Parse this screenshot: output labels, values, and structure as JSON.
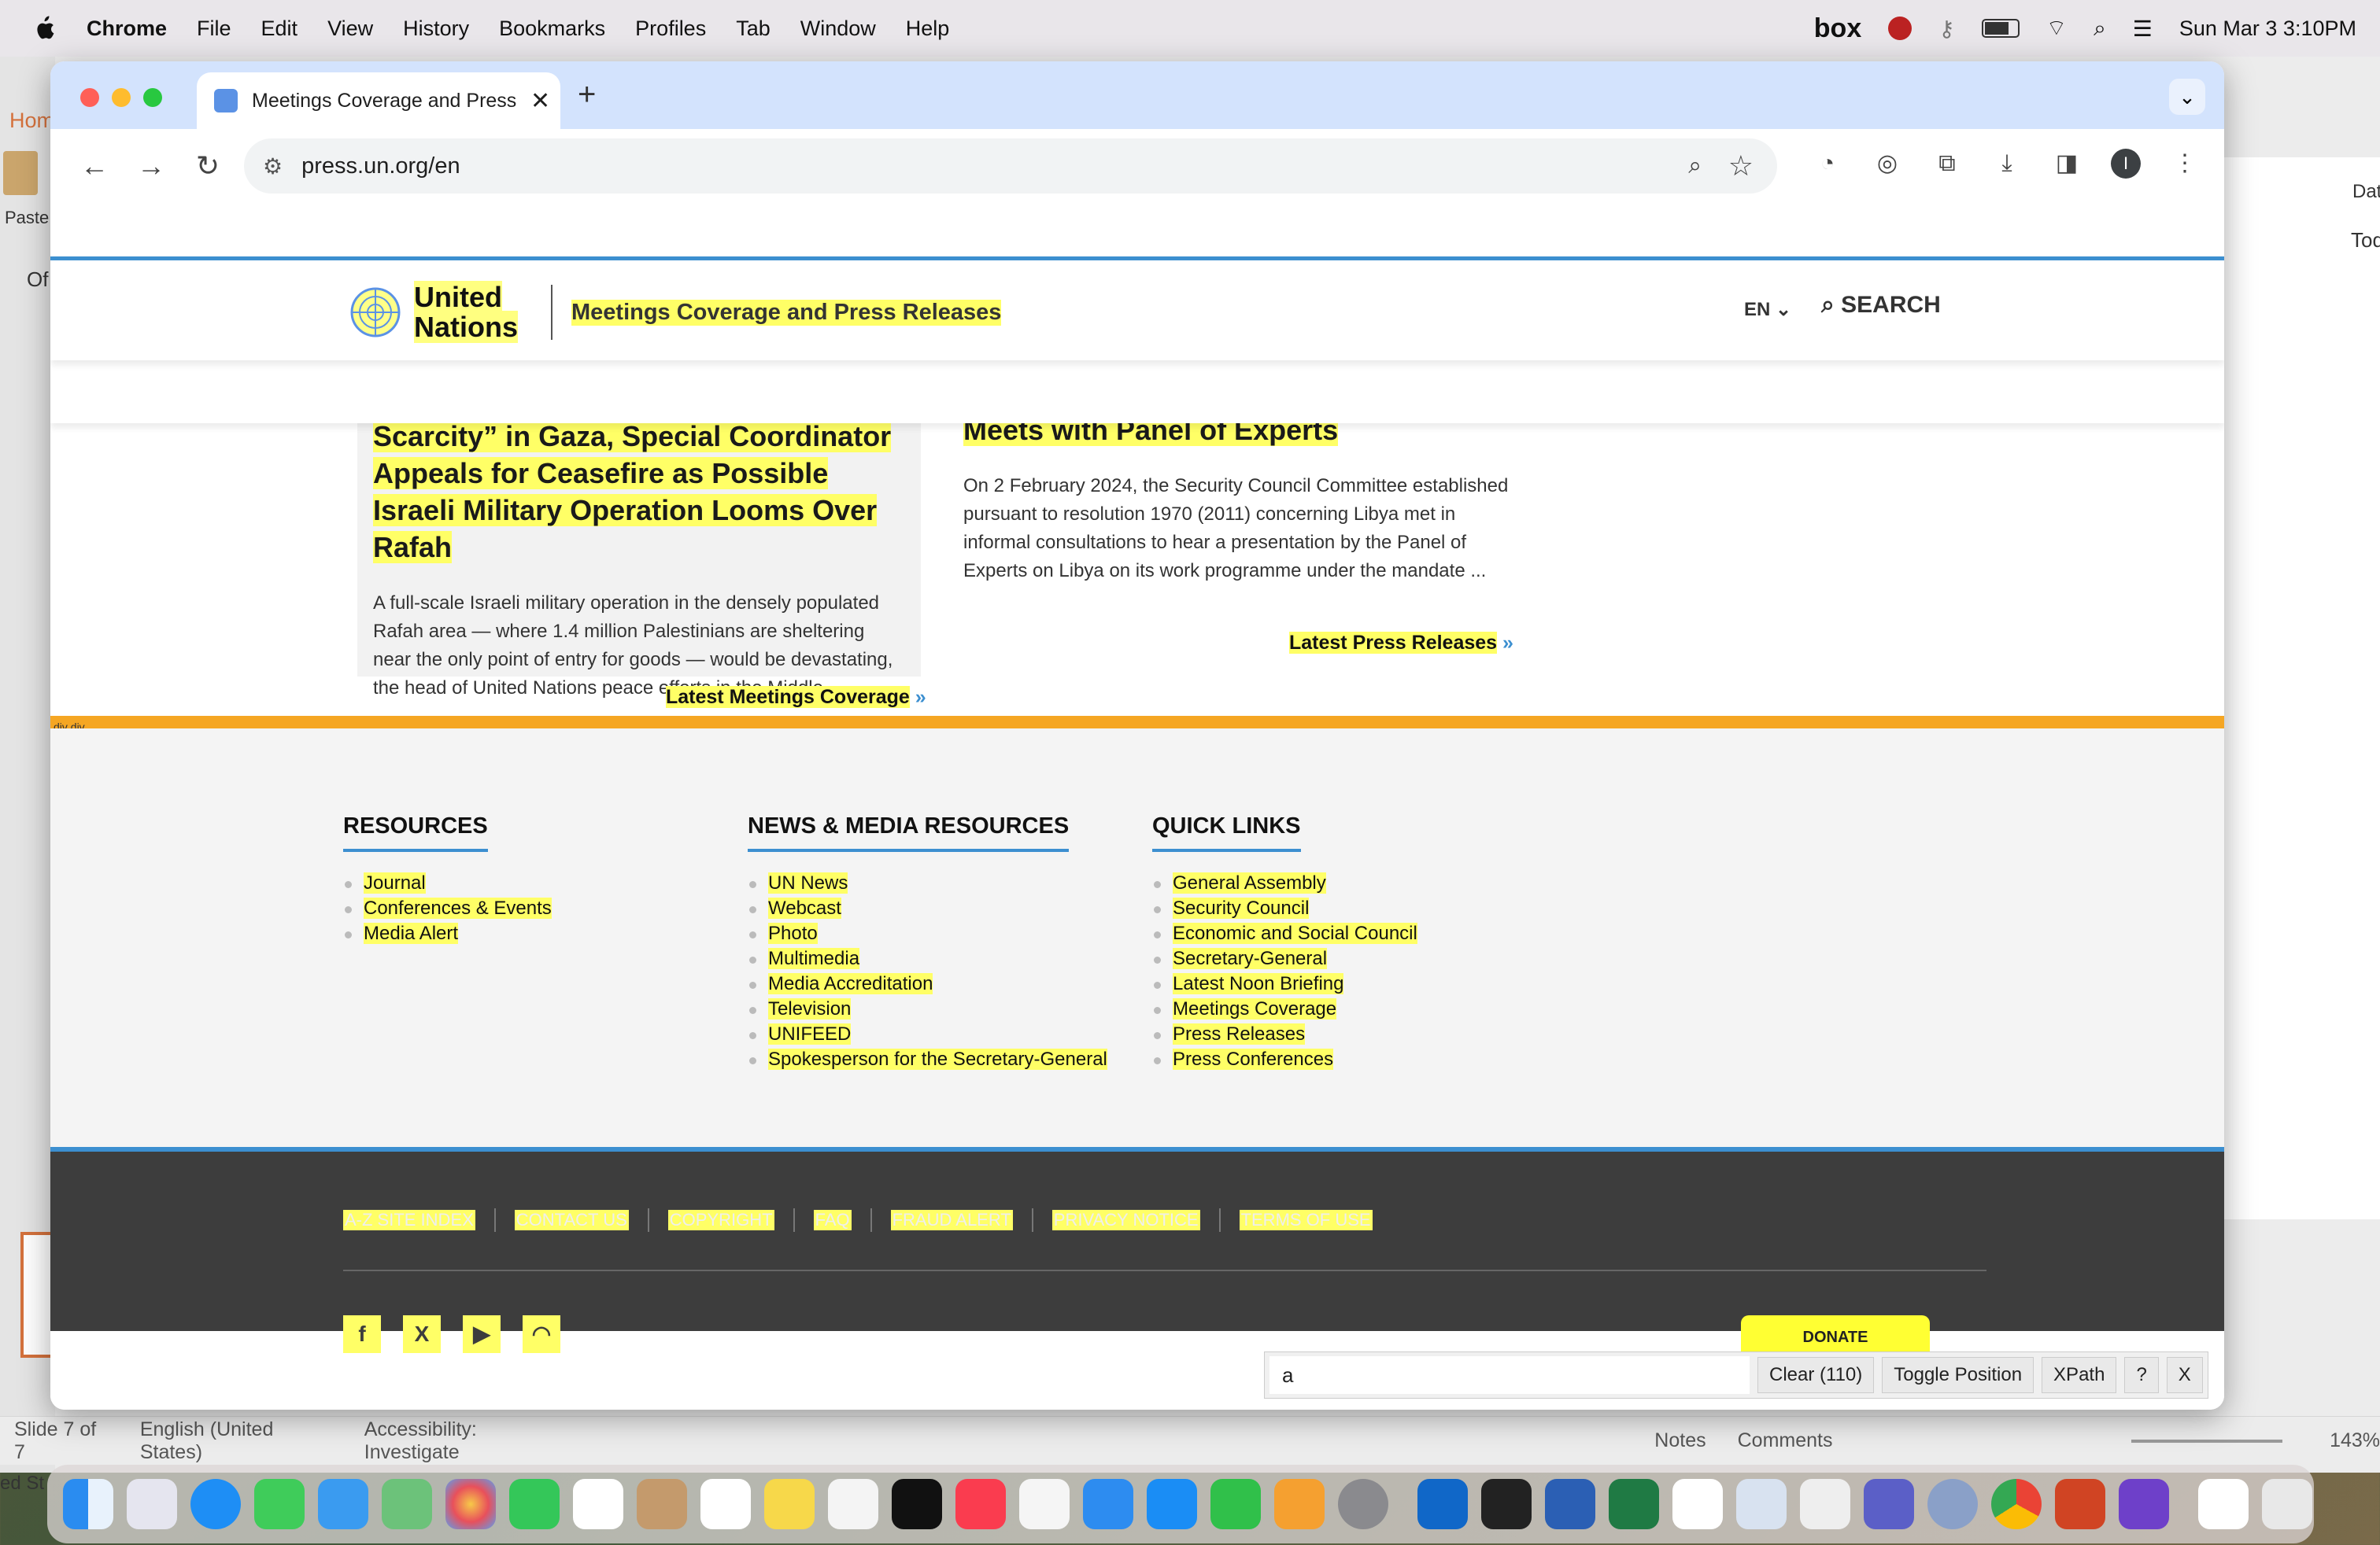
{
  "menubar": {
    "app": "Chrome",
    "items": [
      "File",
      "Edit",
      "View",
      "History",
      "Bookmarks",
      "Profiles",
      "Tab",
      "Window",
      "Help"
    ],
    "box": "box",
    "datetime": "Sun Mar 3  3:10PM"
  },
  "background_app": {
    "status_slide": "Slide 7 of 7",
    "status_lang": "English (United States)",
    "status_access": "Accessibility: Investigate",
    "notes": "Notes",
    "comments": "Comments",
    "zoom": "143%",
    "paste": "Paste",
    "hom": "Hom",
    "of": "Of",
    "dat": "Dat",
    "tod": "Tod",
    "eds": "ed St"
  },
  "browser": {
    "tab_title": "Meetings Coverage and Press Releases",
    "url": "press.un.org/en"
  },
  "page": {
    "logo_line1": "United",
    "logo_line2": "Nations",
    "site_name": "Meetings Coverage and Press Releases",
    "lang": "EN",
    "search": "SEARCH",
    "card1": {
      "title": "Underlining “Desperation and Scarcity” in Gaza, Special Coordinator Appeals for Ceasefire as Possible Israeli Military Operation Looms Over Rafah",
      "body": "A full-scale Israeli military operation in the densely populated Rafah area — where 1.4 million Palestinians are sheltering near the only point of entry for goods — would be devastating, the head of United Nations peace efforts in the Middle ...",
      "more": "Latest Meetings Coverage"
    },
    "card2": {
      "title": "Security Council Committee on Libya Meets with Panel of Experts",
      "body": "On 2 February 2024, the Security Council Committee established pursuant to resolution 1970 (2011) concerning Libya met in informal consultations to hear a presentation by the Panel of Experts on Libya on its work programme under the mandate ...",
      "more": "Latest Press Releases"
    },
    "divlabel": "div div",
    "resources": {
      "heading": "RESOURCES",
      "items": [
        "Journal",
        "Conferences & Events",
        "Media Alert"
      ]
    },
    "news": {
      "heading": "NEWS & MEDIA RESOURCES",
      "items": [
        "UN News",
        "Webcast",
        "Photo",
        "Multimedia",
        "Media Accreditation",
        "Television",
        "UNIFEED",
        "Spokesperson for the Secretary-General"
      ]
    },
    "quick": {
      "heading": "QUICK LINKS",
      "items": [
        "General Assembly",
        "Security Council",
        "Economic and Social Council",
        "Secretary-General",
        "Latest Noon Briefing",
        "Meetings Coverage",
        "Press Releases",
        "Press Conferences"
      ]
    },
    "footer_links": [
      "A-Z SITE INDEX",
      "CONTACT US",
      "COPYRIGHT",
      "FAQ",
      "FRAUD ALERT",
      "PRIVACY NOTICE",
      "TERMS OF USE"
    ],
    "donate": "DONATE"
  },
  "xpath_bar": {
    "input": "a",
    "clear": "Clear (110)",
    "toggle": "Toggle Position",
    "xpath": "XPath",
    "help": "?",
    "close": "X"
  },
  "colors": {
    "highlight": "#ffff66",
    "un_blue": "#3c8fd0",
    "orange": "#f5a623",
    "footer_dark": "#3d3d3d"
  }
}
